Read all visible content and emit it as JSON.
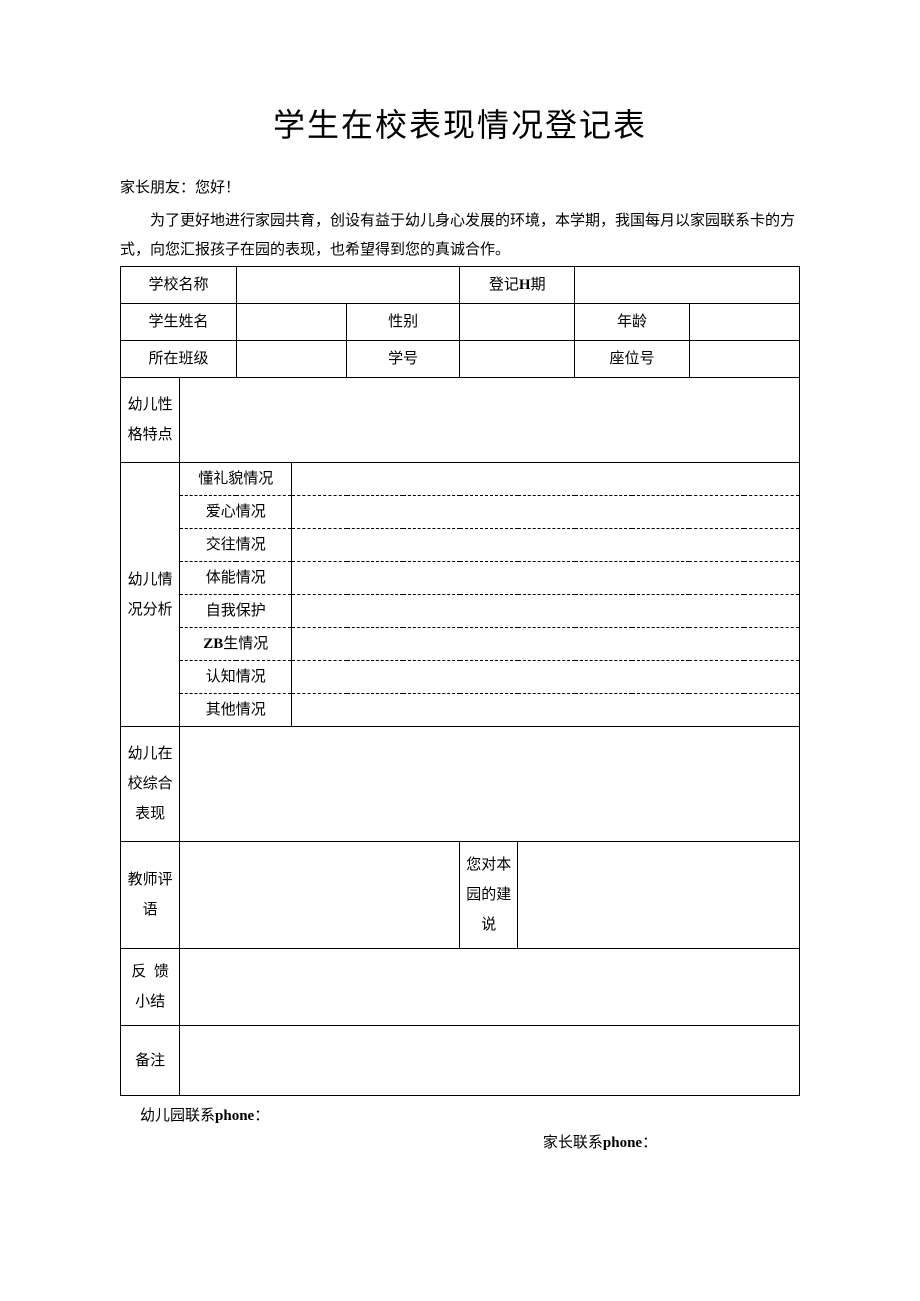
{
  "title": "学生在校表现情况登记表",
  "greeting": "家长朋友：您好！",
  "intro": "为了更好地进行家园共育，创设有益于幼儿身心发展的环境，本学期，我国每月以家园联系卡的方式，向您汇报孩子在园的表现，也希望得到您的真诚合作。",
  "row1": {
    "school_label": "学校名称",
    "school_value": "",
    "reg_date_label_prefix": "登记",
    "reg_date_label_bold": "H",
    "reg_date_label_suffix": "期",
    "reg_date_value": ""
  },
  "row2": {
    "name_label": "学生姓名",
    "name_value": "",
    "gender_label": "性别",
    "gender_value": "",
    "age_label": "年龄",
    "age_value": ""
  },
  "row3": {
    "class_label": "所在班级",
    "class_value": "",
    "student_no_label": "学号",
    "student_no_value": "",
    "seat_no_label": "座位号",
    "seat_no_value": ""
  },
  "personality_label": "幼儿性格特点",
  "personality_value": "",
  "analysis": {
    "section_label": "幼儿情况分析",
    "items": [
      {
        "label": "懂礼貌情况",
        "value": ""
      },
      {
        "label": "爱心情况",
        "value": ""
      },
      {
        "label": "交往情况",
        "value": ""
      },
      {
        "label": "体能情况",
        "value": ""
      },
      {
        "label": "自我保护",
        "value": ""
      },
      {
        "label_prefix": "ZB",
        "label_suffix": "生情况",
        "value": ""
      },
      {
        "label": "认知情况",
        "value": ""
      },
      {
        "label": "其他情况",
        "value": ""
      }
    ]
  },
  "overall_label": "幼儿在校综合表现",
  "overall_value": "",
  "teacher_comment_label": "教师评语",
  "teacher_comment_value": "",
  "parent_suggestion_label": "您对本园的建说",
  "parent_suggestion_value": "",
  "feedback_label_1": "反",
  "feedback_label_2": "馈",
  "feedback_label_3": "小结",
  "feedback_value": "",
  "remarks_label": "备注",
  "remarks_value": "",
  "footer": {
    "line1_prefix": "幼儿园联系",
    "line1_bold": "phone",
    "line1_suffix": "：",
    "line2_prefix": "家长联系",
    "line2_bold": "phone",
    "line2_suffix": "："
  }
}
